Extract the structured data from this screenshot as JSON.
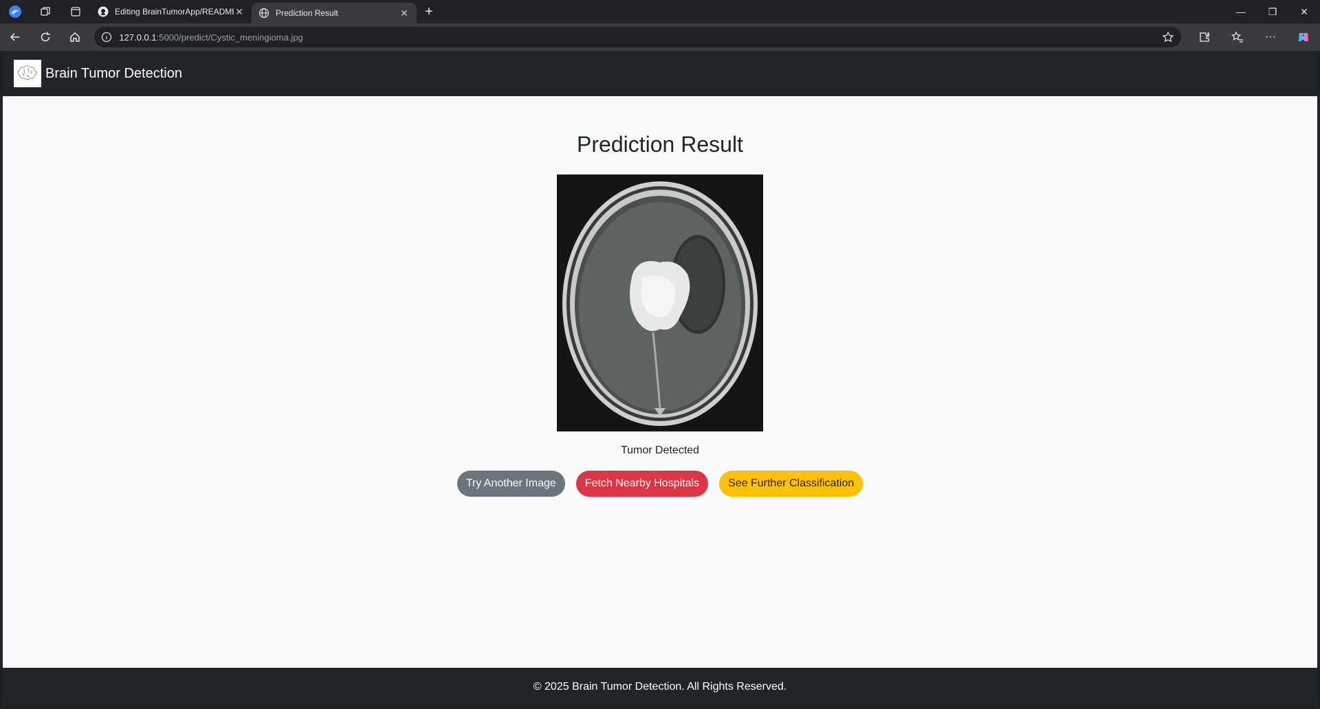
{
  "browser": {
    "tabs": [
      {
        "title": "Editing BrainTumorApp/README",
        "icon": "github-icon",
        "active": false
      },
      {
        "title": "Prediction Result",
        "icon": "globe-icon",
        "active": true
      }
    ],
    "url_host": "127.0.0.1",
    "url_path": ":5000/predict/Cystic_meningioma.jpg",
    "new_tab_label": "+"
  },
  "navbar": {
    "brand": "Brain Tumor Detection",
    "logo_icon": "brain-icon"
  },
  "main": {
    "title": "Prediction Result",
    "image_alt": "Cystic_meningioma.jpg",
    "result_text": "Tumor Detected",
    "buttons": {
      "try_another": "Try Another Image",
      "fetch_hospitals": "Fetch Nearby Hospitals",
      "further_classification": "See Further Classification"
    }
  },
  "footer": {
    "text": "© 2025 Brain Tumor Detection. All Rights Reserved."
  },
  "colors": {
    "navbar_bg": "#212529",
    "page_bg": "#f8f9fa",
    "btn_secondary": "#6c757d",
    "btn_danger": "#dc3545",
    "btn_warning": "#ffc107"
  }
}
